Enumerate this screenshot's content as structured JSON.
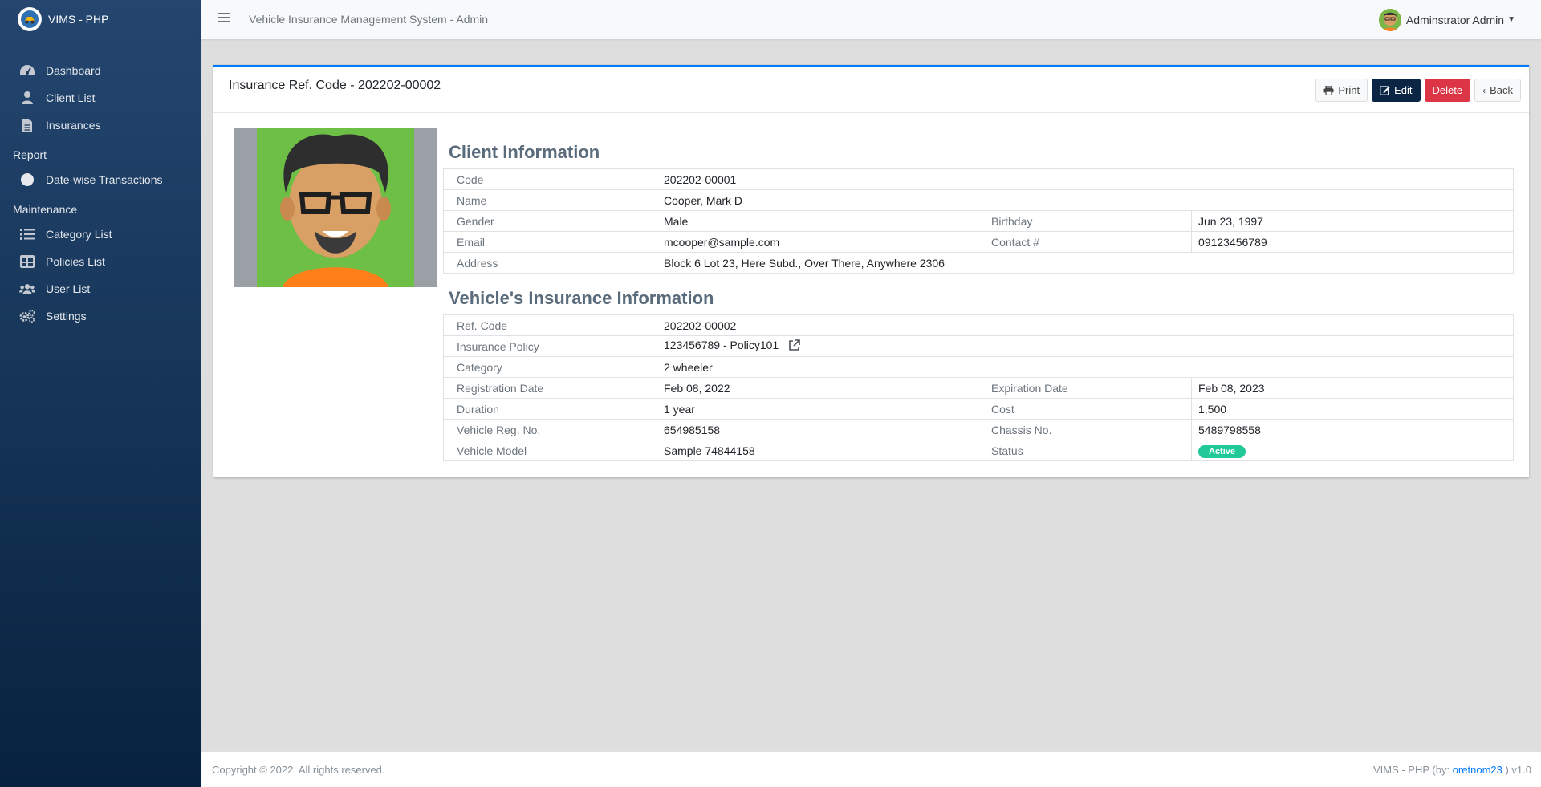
{
  "brand": {
    "name": "VIMS - PHP"
  },
  "topbar": {
    "title": "Vehicle Insurance Management System - Admin",
    "user": "Adminstrator Admin"
  },
  "sidebar": {
    "items": [
      {
        "label": "Dashboard",
        "icon": "dashboard-icon"
      },
      {
        "label": "Client List",
        "icon": "user-icon"
      },
      {
        "label": "Insurances",
        "icon": "file-icon"
      }
    ],
    "report_header": "Report",
    "report_items": [
      {
        "label": "Date-wise Transactions",
        "icon": "circle-icon"
      }
    ],
    "maintenance_header": "Maintenance",
    "maintenance_items": [
      {
        "label": "Category List",
        "icon": "list-icon"
      },
      {
        "label": "Policies List",
        "icon": "table-icon"
      },
      {
        "label": "User List",
        "icon": "users-icon"
      },
      {
        "label": "Settings",
        "icon": "gears-icon"
      }
    ]
  },
  "card": {
    "title": "Insurance Ref. Code - 202202-00002",
    "buttons": {
      "print": "Print",
      "edit": "Edit",
      "delete": "Delete",
      "back": "Back"
    }
  },
  "client": {
    "section_title": "Client Information",
    "code_label": "Code",
    "code": "202202-00001",
    "name_label": "Name",
    "name": "Cooper, Mark D",
    "gender_label": "Gender",
    "gender": "Male",
    "birthday_label": "Birthday",
    "birthday": "Jun 23, 1997",
    "email_label": "Email",
    "email": "mcooper@sample.com",
    "contact_label": "Contact #",
    "contact": "09123456789",
    "address_label": "Address",
    "address": "Block 6 Lot 23, Here Subd., Over There, Anywhere 2306"
  },
  "vehicle": {
    "section_title": "Vehicle's Insurance Information",
    "ref_label": "Ref. Code",
    "ref": "202202-00002",
    "policy_label": "Insurance Policy",
    "policy": "123456789 - Policy101",
    "category_label": "Category",
    "category": "2 wheeler",
    "reg_date_label": "Registration Date",
    "reg_date": "Feb 08, 2022",
    "exp_date_label": "Expiration Date",
    "exp_date": "Feb 08, 2023",
    "duration_label": "Duration",
    "duration": "1 year",
    "cost_label": "Cost",
    "cost": "1,500",
    "reg_no_label": "Vehicle Reg. No.",
    "reg_no": "654985158",
    "chassis_label": "Chassis No.",
    "chassis": "5489798558",
    "model_label": "Vehicle Model",
    "model": "Sample 74844158",
    "status_label": "Status",
    "status": "Active"
  },
  "footer": {
    "copyright": "Copyright © 2022. All rights reserved.",
    "credit_prefix": "VIMS - PHP (by:",
    "credit_author": "oretnom23",
    "credit_suffix": ") v1.0"
  },
  "colors": {
    "accent": "#007bff",
    "edit": "#0b2545",
    "delete": "#dc3545",
    "status_active": "#20c997"
  }
}
